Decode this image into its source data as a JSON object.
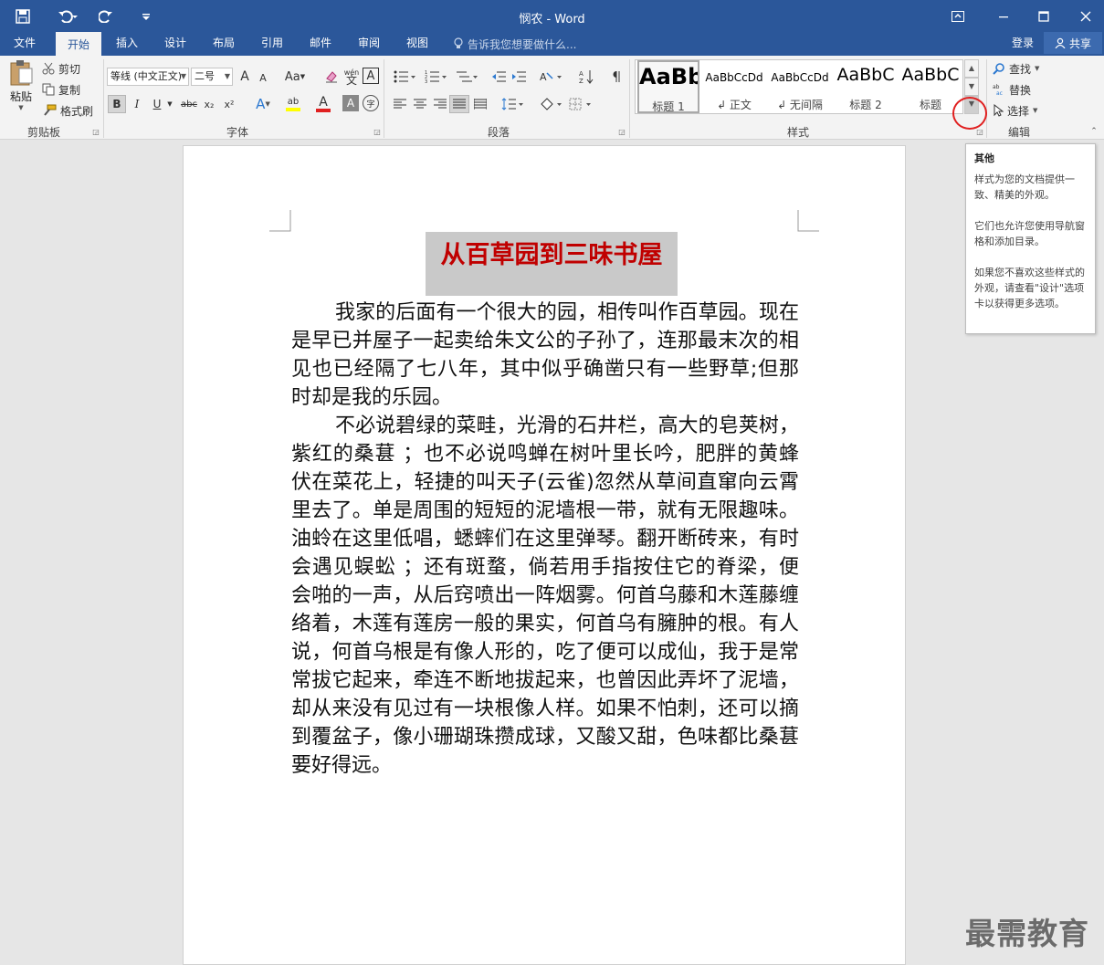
{
  "window": {
    "title": "悯农 - Word",
    "save_icon": "save-icon",
    "undo_icon": "undo-icon",
    "redo_icon": "redo-icon",
    "customize_icon": "customize-quick-access-icon",
    "ribbon_display_icon": "ribbon-display-options-icon",
    "minimize_icon": "minimize-icon",
    "maximize_icon": "maximize-icon",
    "close_icon": "close-icon"
  },
  "tabs": [
    "文件",
    "开始",
    "插入",
    "设计",
    "布局",
    "引用",
    "邮件",
    "审阅",
    "视图"
  ],
  "active_tab": "开始",
  "tell_me": "告诉我您想要做什么...",
  "signin": "登录",
  "share": "共享",
  "clipboard": {
    "paste": "粘贴",
    "cut": "剪切",
    "copy": "复制",
    "format_painter": "格式刷",
    "label": "剪贴板"
  },
  "font": {
    "name": "等线 (中文正文)",
    "size": "二号",
    "label": "字体",
    "grow": "A",
    "shrink": "A",
    "case": "Aa",
    "phonetic": "wén",
    "border_char": "A",
    "bold": "B",
    "italic": "I",
    "underline": "U",
    "strike": "abc",
    "subscript": "x₂",
    "superscript": "x²",
    "effects": "A",
    "highlight": "ab",
    "font_color": "A",
    "shading": "A",
    "enclose": "字"
  },
  "paragraph": {
    "label": "段落"
  },
  "styles": {
    "label": "样式",
    "items": [
      {
        "preview": "AaBb",
        "name": "标题 1"
      },
      {
        "preview": "AaBbCcDd",
        "name": "↲ 正文"
      },
      {
        "preview": "AaBbCcDd",
        "name": "↲ 无间隔"
      },
      {
        "preview": "AaBbC",
        "name": "标题 2"
      },
      {
        "preview": "AaBbC",
        "name": "标题"
      }
    ]
  },
  "editing": {
    "find": "查找",
    "replace": "替换",
    "select": "选择",
    "label": "编辑"
  },
  "document": {
    "title": "从百草园到三味书屋",
    "paragraphs": [
      "我家的后面有一个很大的园，相传叫作百草园。现在是早已并屋子一起卖给朱文公的子孙了，连那最末次的相见也已经隔了七八年，其中似乎确凿只有一些野草;但那时却是我的乐园。",
      "不必说碧绿的菜畦，光滑的石井栏，高大的皂荚树，紫红的桑葚 ；也不必说鸣蝉在树叶里长吟，肥胖的黄蜂伏在菜花上，轻捷的叫天子(云雀)忽然从草间直窜向云霄里去了。单是周围的短短的泥墙根一带，就有无限趣味。油蛉在这里低唱，蟋蟀们在这里弹琴。翻开断砖来，有时会遇见蜈蚣 ；还有斑蝥，倘若用手指按住它的脊梁，便会啪的一声，从后窍喷出一阵烟雾。何首乌藤和木莲藤缠络着，木莲有莲房一般的果实，何首乌有臃肿的根。有人说，何首乌根是有像人形的，吃了便可以成仙，我于是常常拔它起来，牵连不断地拔起来，也曾因此弄坏了泥墙，却从来没有见过有一块根像人样。如果不怕刺，还可以摘到覆盆子，像小珊瑚珠攒成球，又酸又甜，色味都比桑葚要好得远。"
    ]
  },
  "tooltip": {
    "title": "其他",
    "lines": [
      "样式为您的文档提供一致、精美的外观。",
      "它们也允许您使用导航窗格和添加目录。",
      "如果您不喜欢这些样式的外观，请查看\"设计\"选项卡以获得更多选项。"
    ]
  },
  "watermark": "最需教育",
  "colors": {
    "accent": "#2b579a",
    "title_red": "#c00000",
    "highlight_circle": "#e02020"
  }
}
